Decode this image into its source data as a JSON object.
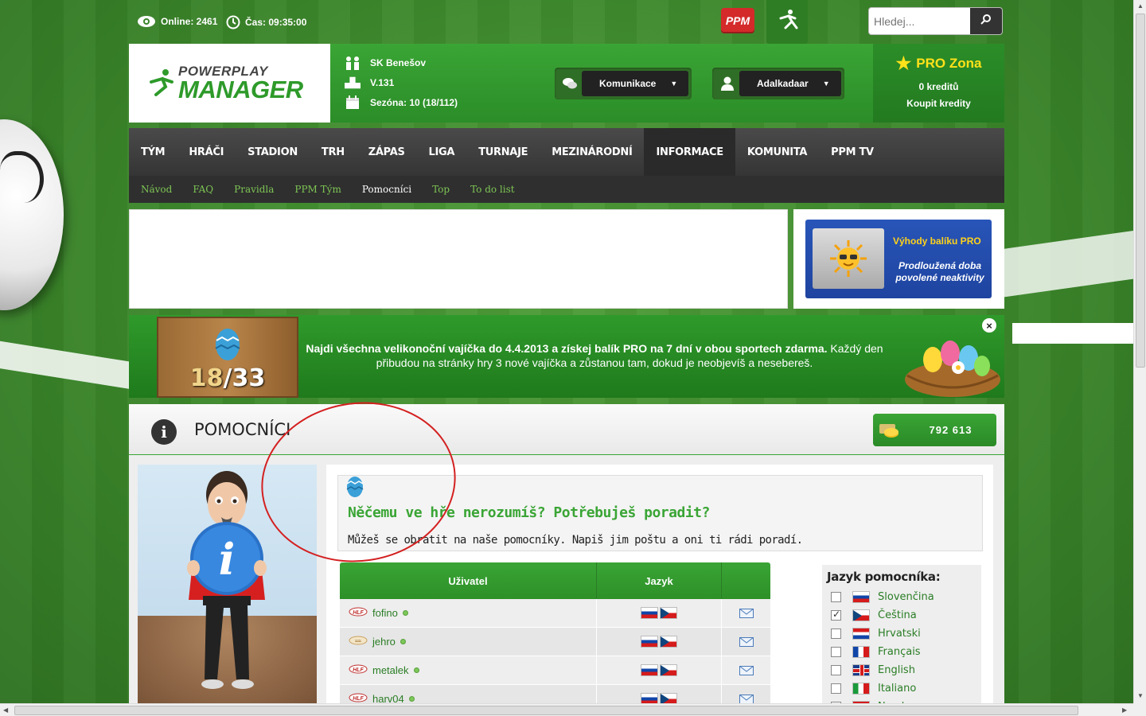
{
  "topbar": {
    "online_label": "Online: 2461",
    "time_label": "Čas: 09:35:00",
    "ppm_label": "PPM",
    "search_placeholder": "Hledej..."
  },
  "header": {
    "logo_top": "POWERPLAY",
    "logo_main": "MANAGER",
    "club_name": "SK Benešov",
    "division": "V.131",
    "season": "Sezóna: 10 (18/112)",
    "comm_label": "Komunikace",
    "user_label": "Adalkadaar",
    "pro_title": "PRO Zona",
    "pro_credits": "0 kreditů",
    "pro_buy": "Koupit kredity"
  },
  "nav": {
    "main": [
      "TÝM",
      "HRÁČI",
      "STADION",
      "TRH",
      "ZÁPAS",
      "LIGA",
      "TURNAJE",
      "MEZINÁRODNÍ",
      "INFORMACE",
      "KOMUNITA",
      "PPM TV"
    ],
    "active_main": 8,
    "sub": [
      "Návod",
      "FAQ",
      "Pravidla",
      "PPM Tým",
      "Pomocníci",
      "Top",
      "To do list"
    ],
    "active_sub": 4
  },
  "promo": {
    "title": "Výhody balíku PRO",
    "text": "Prodloužená doba povolené neaktivity"
  },
  "easter": {
    "count_found": "18",
    "count_total": "/33",
    "text_bold": "Najdi všechna velikonoční vajíčka do 4.4.2013 a získej balík PRO na 7 dní v obou sportech zdarma.",
    "text_rest": " Každý den přibudou na stránky hry 3 nové vajíčka a zůstanou tam, dokud je neobjevíš a nesebereš.",
    "close": "×"
  },
  "main": {
    "title": "POMOCNÍCI",
    "money": "792 613",
    "help_title": "Něčemu ve hře nerozumíš? Potřebuješ poradit?",
    "help_text": "Můžeš se obrátit na naše pomocníky. Napiš jim poštu a oni ti rádi poradí."
  },
  "table": {
    "col_user": "Uživatel",
    "col_lang": "Jazyk",
    "rows": [
      {
        "name": "fofino",
        "sport": "hockey"
      },
      {
        "name": "jehro",
        "sport": "soccer"
      },
      {
        "name": "metalek",
        "sport": "hockey"
      },
      {
        "name": "harv04",
        "sport": "hockey"
      }
    ]
  },
  "languages": {
    "title": "Jazyk pomocníka:",
    "items": [
      {
        "label": "Slovenčina",
        "flag": "sk",
        "checked": false
      },
      {
        "label": "Čeština",
        "flag": "cz",
        "checked": true
      },
      {
        "label": "Hrvatski",
        "flag": "hr",
        "checked": false
      },
      {
        "label": "Français",
        "flag": "fr",
        "checked": false
      },
      {
        "label": "English",
        "flag": "gb",
        "checked": false
      },
      {
        "label": "Italiano",
        "flag": "it",
        "checked": false
      },
      {
        "label": "Norsk",
        "flag": "no",
        "checked": false
      }
    ]
  },
  "colors": {
    "brand_green": "#3aa535",
    "nav_dark": "#3a3a3a",
    "pro_blue": "#2855b8"
  }
}
